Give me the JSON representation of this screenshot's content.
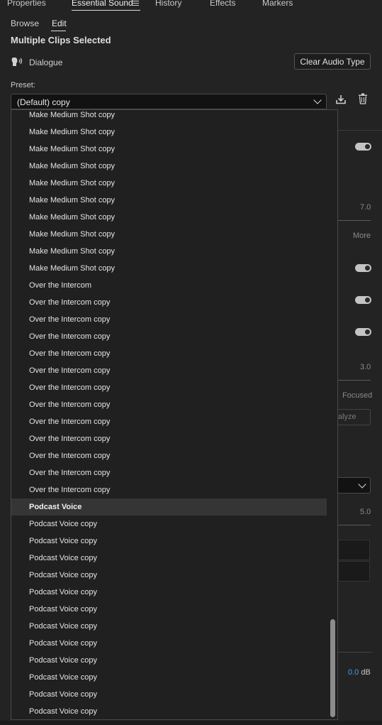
{
  "panel_tabs": [
    {
      "label": "Properties"
    },
    {
      "label": "Essential Sound",
      "active": true
    },
    {
      "label": "History"
    },
    {
      "label": "Effects"
    },
    {
      "label": "Markers"
    }
  ],
  "sub_tabs": [
    {
      "label": "Browse"
    },
    {
      "label": "Edit",
      "active": true
    }
  ],
  "title": "Multiple Clips Selected",
  "audio_type": {
    "label": "Dialogue",
    "icon": "dialogue-icon"
  },
  "clear_button": "Clear Audio Type",
  "preset": {
    "label": "Preset:",
    "value": "(Default) copy"
  },
  "background_panel": {
    "value_1": "7.0",
    "more": "More",
    "value_2": "3.0",
    "focused": "Focused",
    "analyze_partial": "alyze",
    "value_3": "5.0",
    "db_value": "0.0",
    "db_unit": "dB"
  },
  "dropdown_items": [
    {
      "label": "Make Medium Shot copy"
    },
    {
      "label": "Make Medium Shot copy"
    },
    {
      "label": "Make Medium Shot copy"
    },
    {
      "label": "Make Medium Shot copy"
    },
    {
      "label": "Make Medium Shot copy"
    },
    {
      "label": "Make Medium Shot copy"
    },
    {
      "label": "Make Medium Shot copy"
    },
    {
      "label": "Make Medium Shot copy"
    },
    {
      "label": "Make Medium Shot copy"
    },
    {
      "label": "Make Medium Shot copy"
    },
    {
      "label": "Over the Intercom"
    },
    {
      "label": "Over the Intercom copy"
    },
    {
      "label": "Over the Intercom copy"
    },
    {
      "label": "Over the Intercom copy"
    },
    {
      "label": "Over the Intercom copy"
    },
    {
      "label": "Over the Intercom copy"
    },
    {
      "label": "Over the Intercom copy"
    },
    {
      "label": "Over the Intercom copy"
    },
    {
      "label": "Over the Intercom copy"
    },
    {
      "label": "Over the Intercom copy"
    },
    {
      "label": "Over the Intercom copy"
    },
    {
      "label": "Over the Intercom copy"
    },
    {
      "label": "Over the Intercom copy"
    },
    {
      "label": "Podcast Voice",
      "selected": true
    },
    {
      "label": "Podcast Voice copy"
    },
    {
      "label": "Podcast Voice copy"
    },
    {
      "label": "Podcast Voice copy"
    },
    {
      "label": "Podcast Voice copy"
    },
    {
      "label": "Podcast Voice copy"
    },
    {
      "label": "Podcast Voice copy"
    },
    {
      "label": "Podcast Voice copy"
    },
    {
      "label": "Podcast Voice copy"
    },
    {
      "label": "Podcast Voice copy"
    },
    {
      "label": "Podcast Voice copy"
    },
    {
      "label": "Podcast Voice copy"
    },
    {
      "label": "Podcast Voice copy"
    }
  ],
  "colors": {
    "background": "#232323",
    "accent_blue": "#4f9be8",
    "selected_row": "#353535"
  }
}
